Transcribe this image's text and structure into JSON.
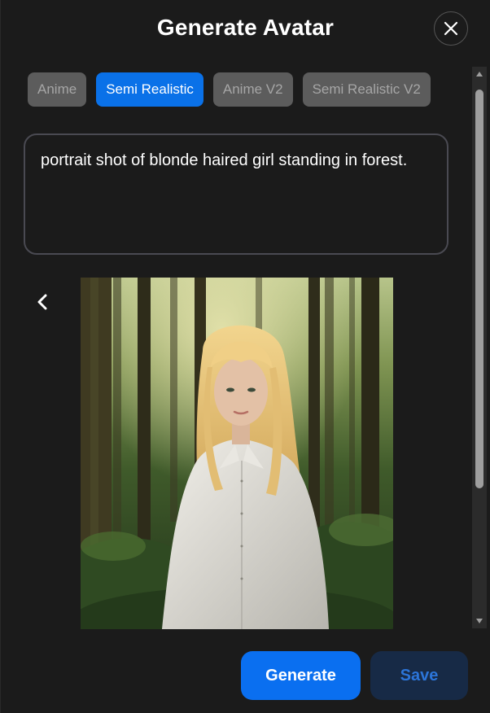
{
  "dialog": {
    "title": "Generate Avatar"
  },
  "style_tabs": [
    {
      "label": "Anime",
      "active": false
    },
    {
      "label": "Semi Realistic",
      "active": true
    },
    {
      "label": "Anime V2",
      "active": false
    },
    {
      "label": "Semi Realistic V2",
      "active": false
    }
  ],
  "prompt": {
    "value": "portrait shot of blonde haired girl standing in forest."
  },
  "preview": {
    "nav_prev_icon": "chevron-left-icon"
  },
  "actions": {
    "generate_label": "Generate",
    "save_label": "Save"
  },
  "colors": {
    "background": "#1b1b1b",
    "accent": "#0a71e8",
    "inactive_tab": "#5c5c5c",
    "save_bg": "#172a46",
    "save_text": "#2c75d9"
  }
}
